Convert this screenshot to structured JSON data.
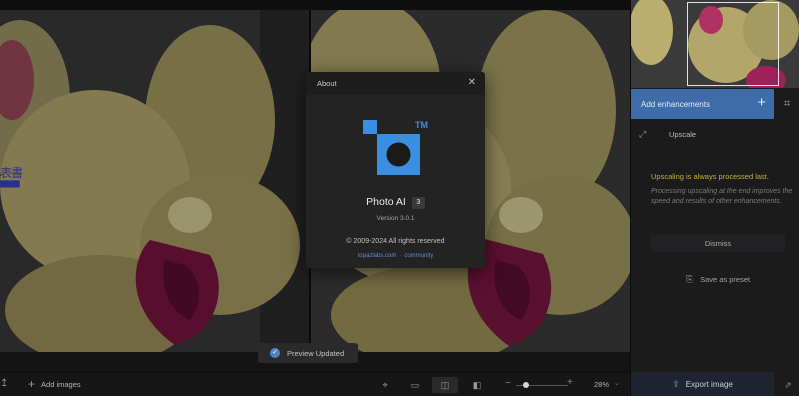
{
  "canvas": {
    "glitch_text": "表書\n■■■"
  },
  "sidebar": {
    "add_enhancements_label": "Add enhancements",
    "add_icon": "plus-icon",
    "crop_icon": "crop-icon",
    "upscale_label": "Upscale",
    "upscale_icon": "expand-arrows-icon",
    "notice_title": "Upscaling is always processed last.",
    "notice_body": "Processing upscaling at the end improves the speed and results of other enhancements.",
    "dismiss_label": "Dismiss",
    "save_preset_label": "Save as preset",
    "save_preset_icon": "save-preset-icon",
    "export_label": "Export image",
    "export_icon": "export-icon",
    "share_icon": "share-icon"
  },
  "toolbar": {
    "add_images_label": "Add images",
    "zoom_value": "28%",
    "zoom_level": 0.19,
    "view_modes": [
      "focus-icon",
      "single-view-icon",
      "side-by-side-icon",
      "split-view-icon"
    ]
  },
  "toast": {
    "label": "Preview Updated"
  },
  "about_dialog": {
    "title": "About",
    "app_name": "Photo AI",
    "major_version": "3",
    "version_text": "Version 3.0.1",
    "copyright": "© 2009-2024 All rights reserved",
    "link_site": "topazlabs.com",
    "link_community": "community",
    "trademark": "TM",
    "brand_color": "#3b8fe0"
  },
  "colors": {
    "accent": "#3d6ca8",
    "warning": "#c2b13b"
  }
}
